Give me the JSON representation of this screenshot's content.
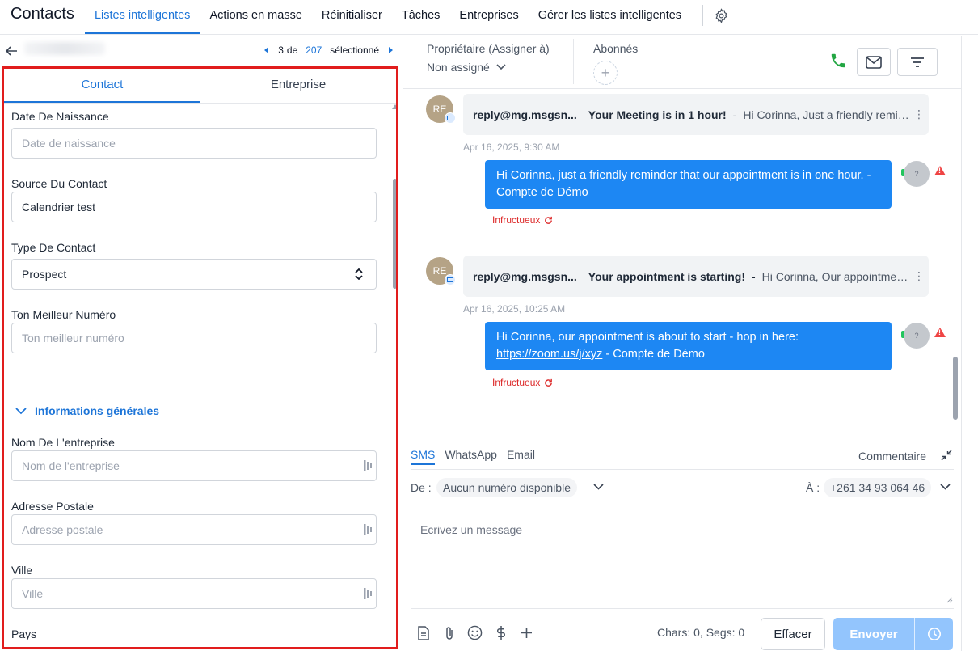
{
  "app": {
    "title": "Contacts"
  },
  "nav": {
    "tabs": [
      "Listes intelligentes",
      "Actions en masse",
      "Réinitialiser",
      "Tâches",
      "Entreprises",
      "Gérer les listes intelligentes"
    ]
  },
  "pager": {
    "position": "3",
    "of_label": "de",
    "total": "207",
    "selected_label": "sélectionné"
  },
  "contact_tabs": {
    "contact": "Contact",
    "company": "Entreprise"
  },
  "form": {
    "birth_label": "Date De Naissance",
    "birth_placeholder": "Date de naissance",
    "source_label": "Source Du Contact",
    "source_value": "Calendrier test",
    "type_label": "Type De Contact",
    "type_value": "Prospect",
    "phone_label": "Ton Meilleur Numéro",
    "phone_placeholder": "Ton meilleur numéro",
    "section_title": "Informations générales",
    "company_label": "Nom De L'entreprise",
    "company_placeholder": "Nom de l'entreprise",
    "address_label": "Adresse Postale",
    "address_placeholder": "Adresse postale",
    "city_label": "Ville",
    "city_placeholder": "Ville",
    "country_label": "Pays"
  },
  "header": {
    "owner_label": "Propriétaire (Assigner à)",
    "owner_value": "Non assigné",
    "followers_label": "Abonnés"
  },
  "messages": [
    {
      "avatar": "RE",
      "from": "reply@mg.msgsn...",
      "subject": "Your Meeting is in 1 hour!",
      "preview": "Hi Corinna, Just a friendly reminder that our appointment is in one hour.",
      "timestamp": "Apr 16, 2025, 9:30 AM",
      "sms": "Hi Corinna, just a friendly reminder that our appointment is in one hour. - Compte de Démo",
      "status": "Infructueux"
    },
    {
      "avatar": "RE",
      "from": "reply@mg.msgsn...",
      "subject": "Your appointment is starting!",
      "preview": "Hi Corinna,  Our appointment is about to start",
      "timestamp": "Apr 16, 2025, 10:25 AM",
      "sms_before": "Hi Corinna, our appointment is about to start - hop in here:",
      "sms_link": "https://zoom.us/j/xyz",
      "sms_after": " - Compte de Démo",
      "status": "Infructueux"
    }
  ],
  "composer": {
    "tabs": [
      "SMS",
      "WhatsApp",
      "Email"
    ],
    "comment": "Commentaire",
    "from_label": "De :",
    "from_value": "Aucun numéro disponible",
    "to_label": "À :",
    "to_value": "+261 34 93 064 46",
    "placeholder": "Ecrivez un message",
    "counter": "Chars: 0, Segs: 0",
    "clear": "Effacer",
    "send": "Envoyer"
  },
  "avatar_unknown": "?",
  "colors": {
    "accent": "#1d75d8",
    "bubble": "#1d87f3",
    "error": "#dc2626",
    "highlight": "#e11d1d"
  }
}
